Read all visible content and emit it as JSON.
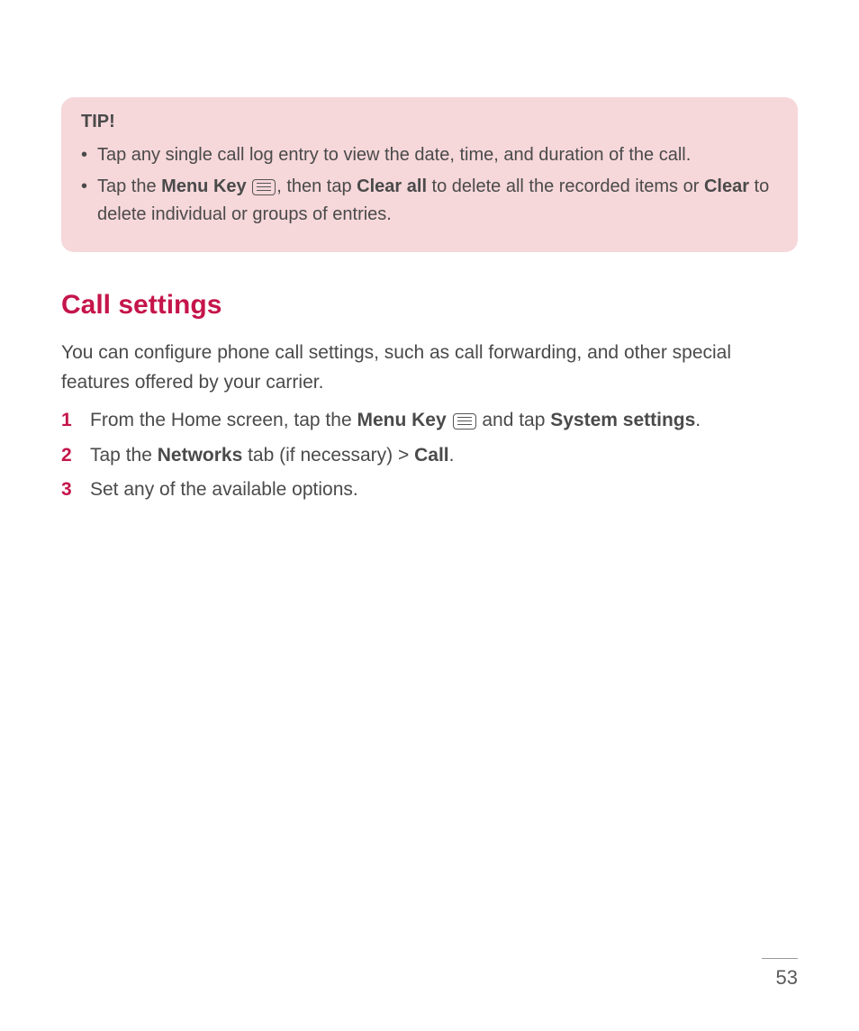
{
  "tip": {
    "title": "TIP!",
    "item1": "Tap any single call log entry to view the date, time, and duration of the call.",
    "item2": {
      "pre": "Tap the ",
      "menuKey": "Menu Key",
      "afterIcon": ", then tap ",
      "clearAll": "Clear all",
      "mid": " to delete all the recorded items or ",
      "clear": "Clear",
      "end": " to delete individual or groups of entries."
    }
  },
  "heading": "Call settings",
  "intro": "You can configure phone call settings, such as call forwarding,  and other special features offered by your carrier.",
  "steps": {
    "s1": {
      "pre": "From the Home screen, tap the ",
      "menuKey": "Menu Key",
      "mid": " and tap ",
      "sys": "System settings",
      "end": "."
    },
    "s2": {
      "pre": "Tap the ",
      "networks": "Networks",
      "mid": " tab (if necessary) > ",
      "call": "Call",
      "end": "."
    },
    "s3": "Set any of the available options."
  },
  "pageNumber": "53"
}
